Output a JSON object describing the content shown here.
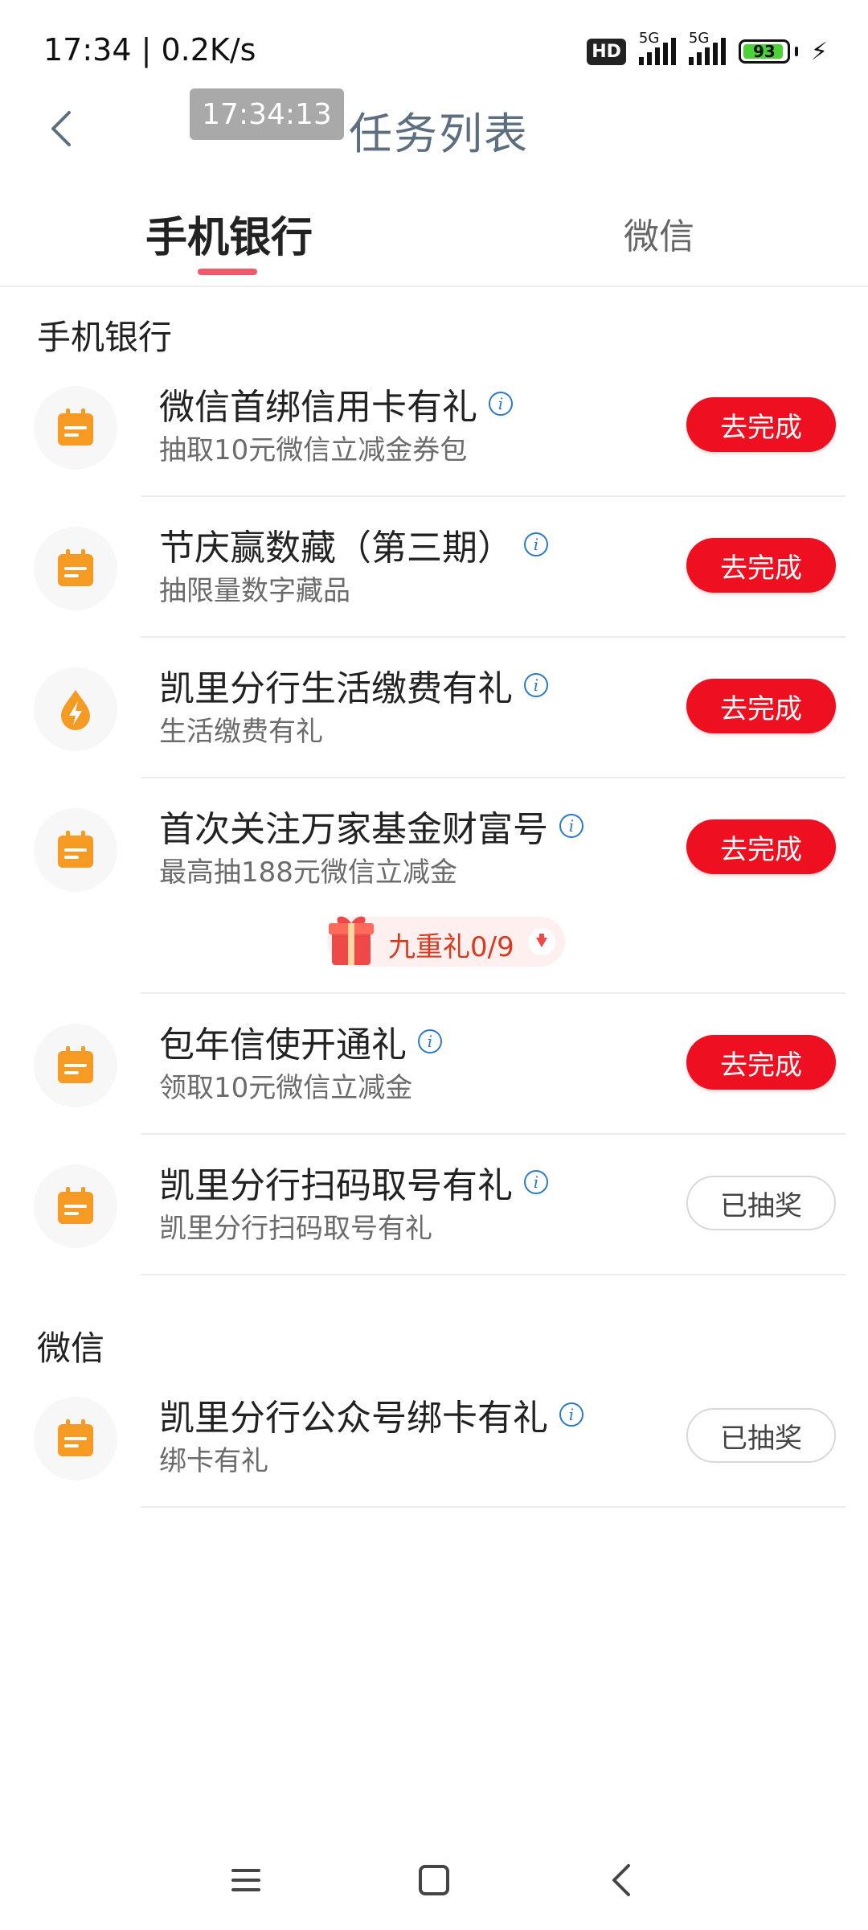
{
  "status_bar": {
    "time": "17:34 | 0.2K/s",
    "hd_label": "HD",
    "signal1_label": "5G",
    "signal2_label": "5G",
    "battery_percent": "93"
  },
  "header": {
    "title": "任务列表",
    "timestamp_overlay": "17:34:13"
  },
  "tabs": {
    "bank_label": "手机银行",
    "wechat_label": "微信",
    "active": "手机银行"
  },
  "sections": [
    {
      "title": "手机银行",
      "tasks": [
        {
          "name": "微信首绑信用卡有礼",
          "desc": "抽取10元微信立减金券包",
          "action": "去完成",
          "icon": "calendar-icon"
        },
        {
          "name": "节庆赢数藏（第三期）",
          "desc": "抽限量数字藏品",
          "action": "去完成",
          "icon": "calendar-icon"
        },
        {
          "name": "凯里分行生活缴费有礼",
          "desc": "生活缴费有礼",
          "action": "去完成",
          "icon": "lightning-drop-icon"
        },
        {
          "name": "首次关注万家基金财富号",
          "desc": "最高抽188元微信立减金",
          "action": "去完成",
          "icon": "calendar-icon"
        },
        {
          "name": "包年信使开通礼",
          "desc": "领取10元微信立减金",
          "action": "去完成",
          "icon": "calendar-icon"
        },
        {
          "name": "凯里分行扫码取号有礼",
          "desc": "凯里分行扫码取号有礼",
          "action": "已抽奖",
          "icon": "calendar-icon"
        }
      ]
    },
    {
      "title": "微信",
      "tasks": [
        {
          "name": "凯里分行公众号绑卡有礼",
          "desc": "绑卡有礼",
          "action": "已抽奖",
          "icon": "calendar-icon"
        }
      ]
    }
  ],
  "gift_pill": {
    "label": "九重礼0/9",
    "icon": "gift-icon"
  },
  "colors": {
    "accent_red": "#ee1020",
    "tab_underline": "#ef5a6a",
    "icon_orange": "#f59a23",
    "info_blue": "#2b79c9"
  }
}
